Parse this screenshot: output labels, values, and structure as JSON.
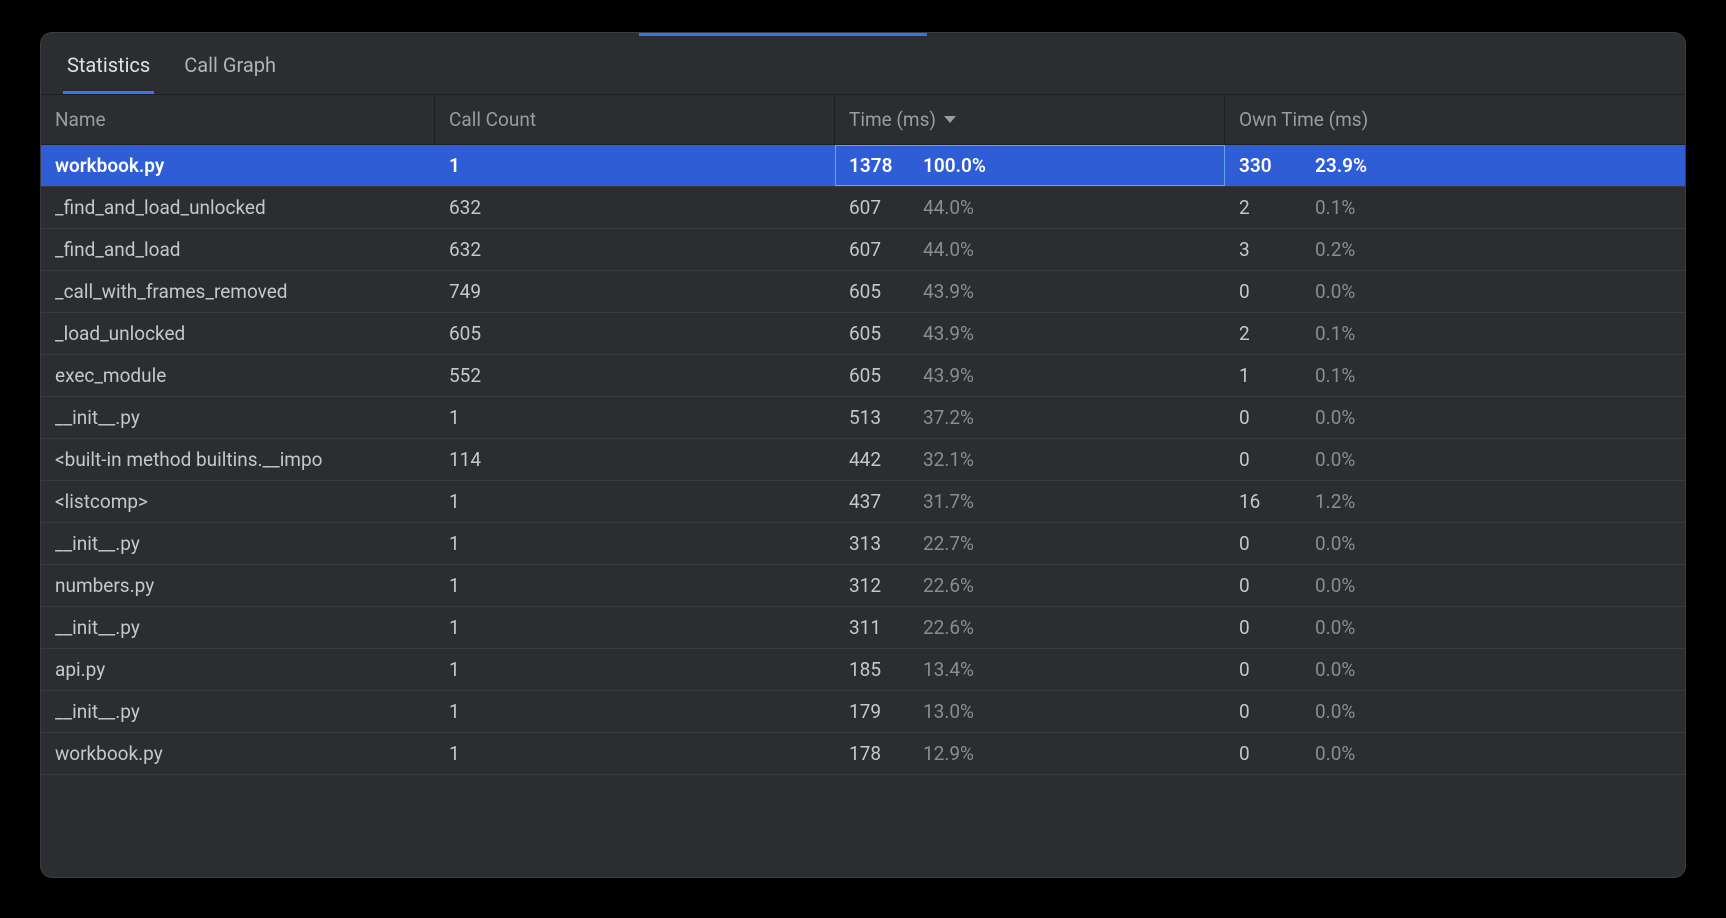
{
  "tabs": [
    {
      "label": "Statistics",
      "active": true
    },
    {
      "label": "Call Graph",
      "active": false
    }
  ],
  "columns": {
    "name": "Name",
    "call_count": "Call Count",
    "time": "Time (ms)",
    "own_time": "Own Time (ms)"
  },
  "sort": {
    "column": "time",
    "dir": "desc"
  },
  "rows": [
    {
      "name": "workbook.py",
      "calls": "1",
      "time": "1378",
      "time_pct": "100.0%",
      "own": "330",
      "own_pct": "23.9%",
      "selected": true
    },
    {
      "name": "_find_and_load_unlocked",
      "calls": "632",
      "time": "607",
      "time_pct": "44.0%",
      "own": "2",
      "own_pct": "0.1%"
    },
    {
      "name": "_find_and_load",
      "calls": "632",
      "time": "607",
      "time_pct": "44.0%",
      "own": "3",
      "own_pct": "0.2%"
    },
    {
      "name": "_call_with_frames_removed",
      "calls": "749",
      "time": "605",
      "time_pct": "43.9%",
      "own": "0",
      "own_pct": "0.0%"
    },
    {
      "name": "_load_unlocked",
      "calls": "605",
      "time": "605",
      "time_pct": "43.9%",
      "own": "2",
      "own_pct": "0.1%"
    },
    {
      "name": "exec_module",
      "calls": "552",
      "time": "605",
      "time_pct": "43.9%",
      "own": "1",
      "own_pct": "0.1%"
    },
    {
      "name": "__init__.py",
      "calls": "1",
      "time": "513",
      "time_pct": "37.2%",
      "own": "0",
      "own_pct": "0.0%"
    },
    {
      "name": "<built-in method builtins.__impo",
      "calls": "114",
      "time": "442",
      "time_pct": "32.1%",
      "own": "0",
      "own_pct": "0.0%"
    },
    {
      "name": "<listcomp>",
      "calls": "1",
      "time": "437",
      "time_pct": "31.7%",
      "own": "16",
      "own_pct": "1.2%"
    },
    {
      "name": "__init__.py",
      "calls": "1",
      "time": "313",
      "time_pct": "22.7%",
      "own": "0",
      "own_pct": "0.0%"
    },
    {
      "name": "numbers.py",
      "calls": "1",
      "time": "312",
      "time_pct": "22.6%",
      "own": "0",
      "own_pct": "0.0%"
    },
    {
      "name": "__init__.py",
      "calls": "1",
      "time": "311",
      "time_pct": "22.6%",
      "own": "0",
      "own_pct": "0.0%"
    },
    {
      "name": "api.py",
      "calls": "1",
      "time": "185",
      "time_pct": "13.4%",
      "own": "0",
      "own_pct": "0.0%"
    },
    {
      "name": "__init__.py",
      "calls": "1",
      "time": "179",
      "time_pct": "13.0%",
      "own": "0",
      "own_pct": "0.0%"
    },
    {
      "name": "workbook.py",
      "calls": "1",
      "time": "178",
      "time_pct": "12.9%",
      "own": "0",
      "own_pct": "0.0%"
    }
  ]
}
